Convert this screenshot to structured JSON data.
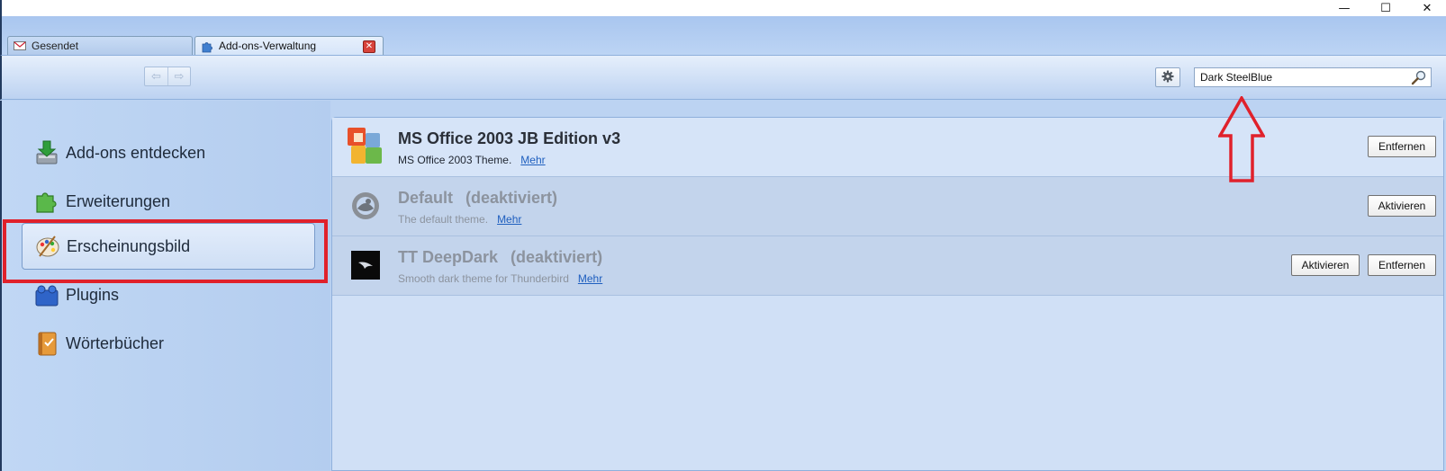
{
  "window": {
    "minimize_glyph": "—",
    "maximize_glyph": "☐",
    "close_glyph": "✕"
  },
  "tabs": [
    {
      "label": "Gesendet",
      "icon": "mail-sent-icon",
      "active": false
    },
    {
      "label": "Add-ons-Verwaltung",
      "icon": "puzzle-icon",
      "active": true
    }
  ],
  "toolbar": {
    "back_glyph": "⇦",
    "forward_glyph": "⇨",
    "tools_icon": "gear-icon",
    "search": {
      "value": "Dark SteelBlue",
      "icon": "search-icon"
    }
  },
  "sidebar": {
    "items": [
      {
        "label": "Add-ons entdecken",
        "icon": "download-icon",
        "selected": false
      },
      {
        "label": "Erweiterungen",
        "icon": "puzzle-icon",
        "selected": false
      },
      {
        "label": "Erscheinungsbild",
        "icon": "palette-icon",
        "selected": true
      },
      {
        "label": "Plugins",
        "icon": "plugin-blocks-icon",
        "selected": false
      },
      {
        "label": "Wörterbücher",
        "icon": "dictionary-icon",
        "selected": false
      }
    ]
  },
  "addons": [
    {
      "name": "MS Office 2003 JB Edition v3",
      "status": "",
      "description": "MS Office 2003 Theme.",
      "more": "Mehr",
      "enabled": true,
      "icon": "ms-office-icon",
      "buttons": [
        "Entfernen"
      ]
    },
    {
      "name": "Default",
      "status": "(deaktiviert)",
      "description": "The default theme.",
      "more": "Mehr",
      "enabled": false,
      "icon": "thunderbird-icon",
      "buttons": [
        "Aktivieren"
      ]
    },
    {
      "name": "TT DeepDark",
      "status": "(deaktiviert)",
      "description": "Smooth dark theme for Thunderbird",
      "more": "Mehr",
      "enabled": false,
      "icon": "deepdark-icon",
      "buttons": [
        "Aktivieren",
        "Entfernen"
      ]
    }
  ],
  "annotations": {
    "highlight_color": "#e0212b",
    "arrow_color": "#e0212b"
  }
}
